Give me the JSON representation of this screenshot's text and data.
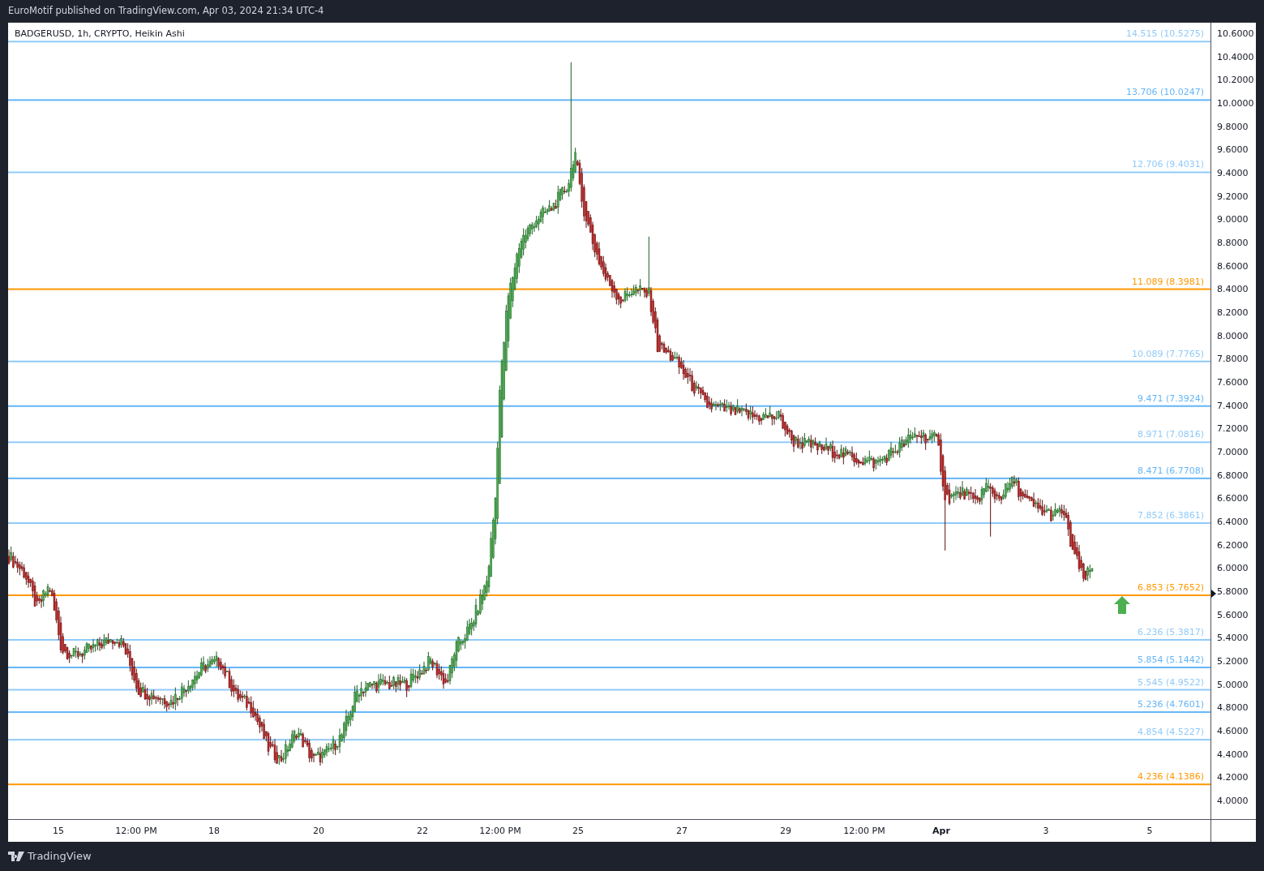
{
  "header": {
    "text": "EuroMotif published on TradingView.com, Apr 03, 2024 21:34 UTC-4"
  },
  "chart": {
    "legend": "BADGERUSD, 1h, CRYPTO, Heikin Ashi",
    "price_axis": [
      "10.6000",
      "10.4000",
      "10.2000",
      "10.0000",
      "9.8000",
      "9.6000",
      "9.4000",
      "9.2000",
      "9.0000",
      "8.8000",
      "8.6000",
      "8.4000",
      "8.2000",
      "8.0000",
      "7.8000",
      "7.6000",
      "7.4000",
      "7.2000",
      "7.0000",
      "6.8000",
      "6.6000",
      "6.4000",
      "6.2000",
      "6.0000",
      "5.8000",
      "5.6000",
      "5.4000",
      "5.2000",
      "5.0000",
      "4.8000",
      "4.6000",
      "4.4000",
      "4.2000",
      "4.0000"
    ],
    "time_axis": [
      {
        "label": "15",
        "bold": false
      },
      {
        "label": "12:00 PM",
        "bold": false
      },
      {
        "label": "18",
        "bold": false
      },
      {
        "label": "20",
        "bold": false
      },
      {
        "label": "22",
        "bold": false
      },
      {
        "label": "12:00 PM",
        "bold": false
      },
      {
        "label": "25",
        "bold": false
      },
      {
        "label": "27",
        "bold": false
      },
      {
        "label": "29",
        "bold": false
      },
      {
        "label": "12:00 PM",
        "bold": false
      },
      {
        "label": "Apr",
        "bold": true
      },
      {
        "label": "3",
        "bold": false
      },
      {
        "label": "5",
        "bold": false
      }
    ],
    "levels": [
      {
        "label": "14.515 (10.5275)",
        "color": "#90caf9"
      },
      {
        "label": "13.706 (10.0247)",
        "color": "#64b5f6"
      },
      {
        "label": "12.706 (9.4031)",
        "color": "#90caf9"
      },
      {
        "label": "11.089 (8.3981)",
        "color": "#ff9800"
      },
      {
        "label": "10.089 (7.7765)",
        "color": "#90caf9"
      },
      {
        "label": "9.471 (7.3924)",
        "color": "#64b5f6"
      },
      {
        "label": "8.971 (7.0816)",
        "color": "#90caf9"
      },
      {
        "label": "8.471 (6.7708)",
        "color": "#64b5f6"
      },
      {
        "label": "7.852 (6.3861)",
        "color": "#90caf9"
      },
      {
        "label": "6.853 (5.7652)",
        "color": "#ff9800"
      },
      {
        "label": "6.236 (5.3817)",
        "color": "#90caf9"
      },
      {
        "label": "5.854 (5.1442)",
        "color": "#64b5f6"
      },
      {
        "label": "5.545 (4.9522)",
        "color": "#90caf9"
      },
      {
        "label": "5.236 (4.7601)",
        "color": "#64b5f6"
      },
      {
        "label": "4.854 (4.5227)",
        "color": "#90caf9"
      },
      {
        "label": "4.236 (4.1386)",
        "color": "#ff9800"
      }
    ]
  },
  "footer": {
    "brand": "TradingView"
  }
}
